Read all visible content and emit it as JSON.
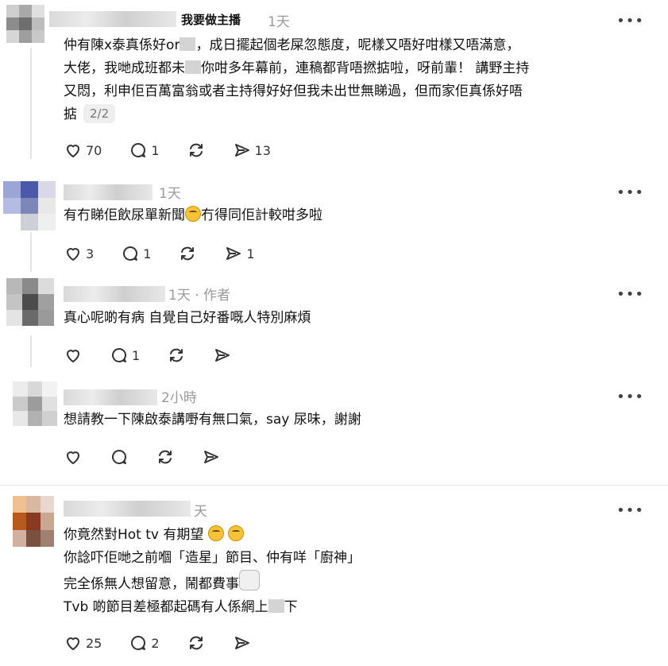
{
  "comments": [
    {
      "username": "我要做主播",
      "time": "1天",
      "lines": [
        "仲有陳x泰真係好or",
        "，成日擺起個老屎忽態度，呢樣又唔好咁樣又唔滿意，",
        "大佬，我哋成班都未",
        "你咁多年幕前，連稿都背唔撚掂啦，呀前輩！ 講野主持",
        "又悶，利申佢百萬富翁或者主持得好好但我未出世無睇過，但而家佢真係好唔",
        "掂"
      ],
      "page_badge": "2/2",
      "likes": "70",
      "replies": "1",
      "reposts": "",
      "shares": "13"
    },
    {
      "username": "",
      "time": "1天",
      "lines": [
        "有冇睇佢飲尿單新聞",
        "冇得同佢計較咁多啦"
      ],
      "likes": "3",
      "replies": "1",
      "reposts": "",
      "shares": "1"
    },
    {
      "username": "",
      "time": "1天 · 作者",
      "lines": [
        "真心呢啲有病 自覺自己好番嘅人特別麻煩"
      ],
      "likes": "",
      "replies": "1",
      "reposts": "",
      "shares": ""
    },
    {
      "username": "",
      "time": "2小時",
      "lines": [
        "想請教一下陳啟泰講嘢有無口氣，say 尿味，謝謝"
      ],
      "likes": "",
      "replies": "",
      "reposts": "",
      "shares": ""
    },
    {
      "username": "",
      "time": "天",
      "lines": [
        "你竟然對Hot tv 有期望",
        "你諗吓佢哋之前嗰「造星」節目、仲有咩「廚神」",
        "完全係無人想留意，鬧都費事",
        "Tvb 啲節目差極都起碼有人係網上",
        "下"
      ],
      "likes": "25",
      "replies": "2",
      "reposts": "",
      "shares": ""
    }
  ],
  "more_label": "•••",
  "colors": {
    "text": "#111111",
    "muted": "#9a9a9a",
    "divider": "#e6e6e6"
  }
}
